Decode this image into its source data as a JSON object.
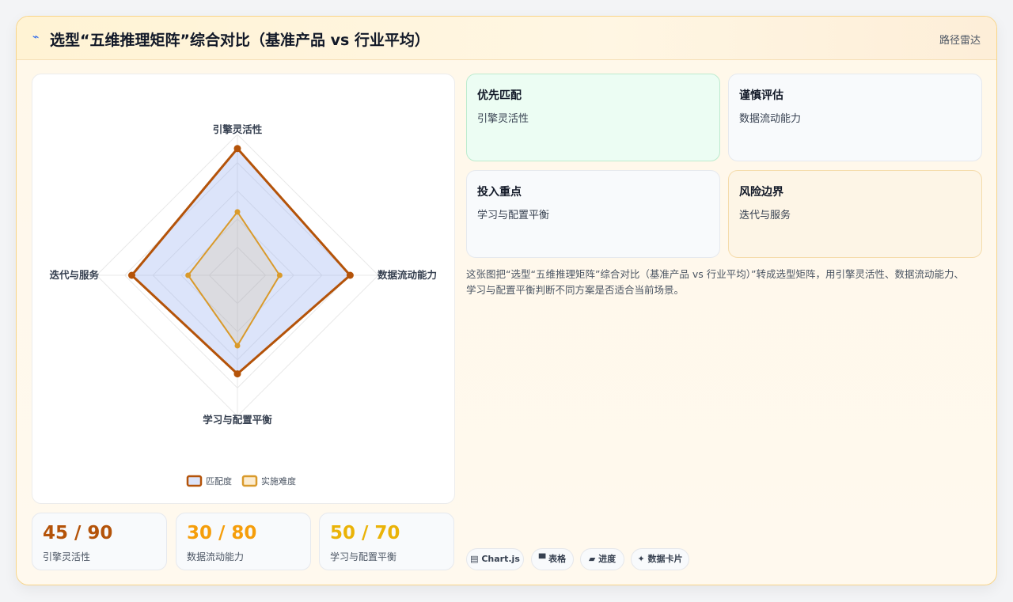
{
  "header": {
    "icon": "⌁",
    "title": "选型“五维推理矩阵”综合对比（基准产品 vs 行业平均）",
    "link": "路径雷达"
  },
  "colors": {
    "match": "#b45309",
    "difficulty": "#d99a2b",
    "match_fill": "rgba(147,172,240,0.32)",
    "difficulty_fill": "rgba(217,154,43,0.12)"
  },
  "chart_data": {
    "type": "radar",
    "axes": [
      "引擎灵活性",
      "数据流动能力",
      "学习与配置平衡",
      "迭代与服务"
    ],
    "scale_max": 100,
    "series": [
      {
        "name": "匹配度",
        "values": [
          90,
          80,
          70,
          75
        ]
      },
      {
        "name": "实施难度",
        "values": [
          45,
          30,
          50,
          35
        ]
      }
    ],
    "legend_position": "bottom-center"
  },
  "stats": [
    {
      "value": "45 / 90",
      "label": "引擎灵活性",
      "color": "#b45309"
    },
    {
      "value": "30 / 80",
      "label": "数据流动能力",
      "color": "#f59e0b"
    },
    {
      "value": "50 / 70",
      "label": "学习与配置平衡",
      "color": "#eab308"
    }
  ],
  "cards": [
    {
      "title": "优先匹配",
      "value": "引擎灵活性"
    },
    {
      "title": "谨慎评估",
      "value": "数据流动能力"
    },
    {
      "title": "投入重点",
      "value": "学习与配置平衡"
    },
    {
      "title": "风险边界",
      "value": "迭代与服务"
    }
  ],
  "description": "这张图把“选型“五维推理矩阵”综合对比（基准产品 vs 行业平均）”转成选型矩阵，用引擎灵活性、数据流动能力、学习与配置平衡判断不同方案是否适合当前场景。",
  "tags": [
    {
      "icon": "▤",
      "label": "Chart.js"
    },
    {
      "icon": "▀",
      "label": "表格"
    },
    {
      "icon": "▰",
      "label": "进度"
    },
    {
      "icon": "✦",
      "label": "数据卡片"
    }
  ]
}
